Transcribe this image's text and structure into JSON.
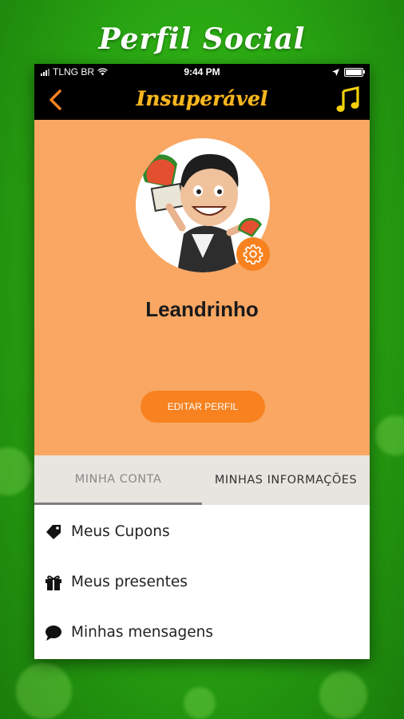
{
  "banner": {
    "title": "Perfil Social"
  },
  "status_bar": {
    "carrier": "TLNG BR",
    "time": "9:44 PM"
  },
  "navbar": {
    "title": "Insuperável",
    "back_icon": "chevron-left-icon",
    "music_icon": "music-note-icon"
  },
  "profile": {
    "username": "Leandrinho",
    "edit_button": "EDITAR PERFIL",
    "settings_icon": "gear-icon"
  },
  "tabs": [
    {
      "label": "MINHA CONTA",
      "active": true
    },
    {
      "label": "MINHAS INFORMAÇÕES",
      "active": false
    }
  ],
  "menu": [
    {
      "label": "Meus Cupons",
      "icon": "tag-icon"
    },
    {
      "label": "Meus presentes",
      "icon": "gift-icon"
    },
    {
      "label": "Minhas mensagens",
      "icon": "chat-bubble-icon"
    }
  ],
  "colors": {
    "accent": "#f7821f",
    "profile_bg": "#f9a762",
    "title_gold": "#f3b81f",
    "bg_green": "#2aa813"
  }
}
